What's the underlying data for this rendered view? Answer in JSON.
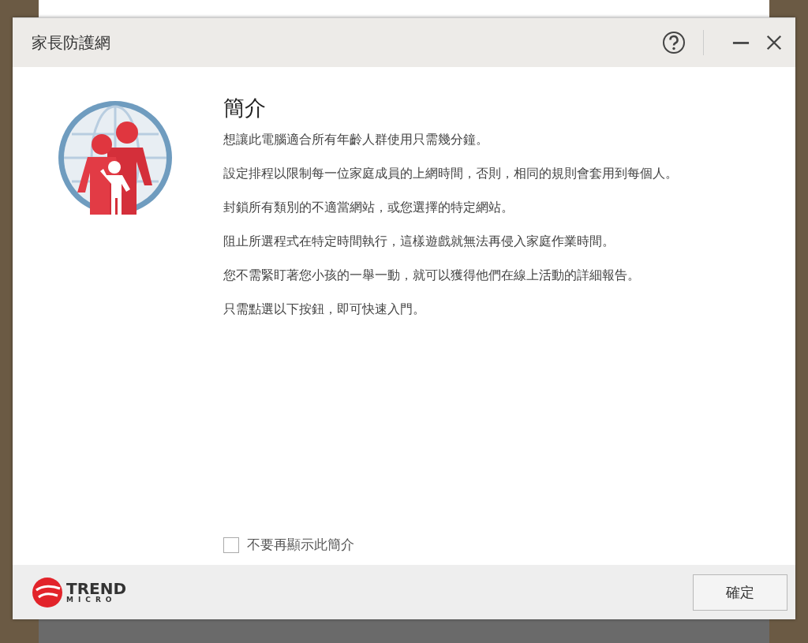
{
  "window": {
    "title": "家長防護網"
  },
  "intro": {
    "heading": "簡介",
    "paragraphs": [
      "想讓此電腦適合所有年齡人群使用只需幾分鐘。",
      "設定排程以限制每一位家庭成員的上網時間，否則，相同的規則會套用到每個人。",
      "封鎖所有類別的不適當網站，或您選擇的特定網站。",
      "阻止所選程式在特定時間執行，這樣遊戲就無法再侵入家庭作業時間。",
      "您不需緊盯著您小孩的一舉一動，就可以獲得他們在線上活動的詳細報告。",
      "只需點選以下按鈕，即可快速入門。"
    ]
  },
  "dont_show_again": {
    "label": "不要再顯示此簡介",
    "checked": false
  },
  "footer": {
    "logo_word": "TREND",
    "logo_subword": "MICRO",
    "ok_button": "確定"
  }
}
